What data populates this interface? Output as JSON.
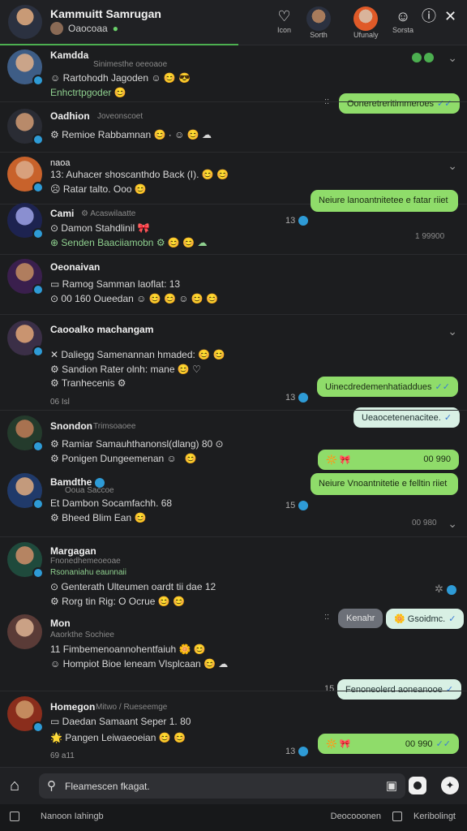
{
  "header": {
    "title": "Kammuitt Samrugan",
    "subtitle": "Oaocoaa",
    "icon_labels": [
      "Icon",
      "Sorth",
      "Ufunaly",
      "Sorsta",
      "",
      ""
    ]
  },
  "chats": [
    {
      "name": "Kamdda",
      "meta": "Sinimesthe oeeoaoe",
      "line1": "Rartohodh  Jagoden",
      "line2": "Enhctrtpgoder",
      "bubble": "Ooneretreritimmeroes",
      "tick": "✓✓"
    },
    {
      "name": "Oadhion",
      "meta": "Joveonscoet",
      "line1": "Remioe  Rabbamnan",
      "bubble": ""
    },
    {
      "name": "naoa",
      "line1": "Auhacer shoscanthdo Back (I).",
      "line2": "Ratar  talto. Ooo",
      "bubble": ""
    },
    {
      "name": "Cami",
      "meta": "Acaswilaatte",
      "line1": "Damon Stahdlinil",
      "line2": "Senden  Baaciiamobn",
      "bubble": "Neiure lanoantnitetee e fatar riiet",
      "count": "13",
      "time": "1 99900"
    },
    {
      "name": "Oeonaivan",
      "line1": "Ramog Samman laoflat: 13",
      "line2": "00  160  Oueedan",
      "bubble": ""
    },
    {
      "name": "Caooalko machangam",
      "line1": "Daliegg Samenannan hmaded:",
      "line2": "Sandion  Rater olnh:  mane",
      "line3": "Tranhecenis",
      "small": "06 Isl",
      "bubble": "Uinecdredemenhatiaddues",
      "bubble2": "Ueaocetenenacitee.",
      "count": "13"
    },
    {
      "name": "Snondon",
      "meta": "Trimsoaoee",
      "line1": "Ramiar Samauhthanonsl(dlang) 80",
      "line2": "Ponigen  Dungeemenan",
      "bubble": "",
      "time": "00 990"
    },
    {
      "name": "Bamdthe",
      "meta": "Ooua Saccoe",
      "line1": "Et Dambon Socamfachh. 68",
      "line2": "Bheed  Blim  Ean",
      "bubble": "Neiure Vnoantnitetie e felltin riiet",
      "count": "15",
      "time": "00 980"
    },
    {
      "name": "Margagan",
      "meta": "Fnonedhemeoeoae",
      "meta2": "Rsonaniahu  eaunnaii",
      "line1": "Genterath  Ulteumen oardt tii dae 12",
      "line2": "Rorg tin  Rig:  O Ocrue",
      "bubble_grey": "Kenahr",
      "bubble": "Gsoidmc."
    },
    {
      "name": "Mon",
      "meta": "Aaorkthe Sochiee",
      "line1": "11  Fimbemenoannohentfaiuh",
      "line2": "Hompiot  Bioe leneam  Vlsplcaan",
      "bubble": "Fenoneolerd aoneanooe",
      "count": "15"
    },
    {
      "name": "Homegon",
      "meta": "Mitwo / Rueseemge",
      "line1": "Daedan Samaant Seper 1. 80",
      "line2": "Pangen  Leiwaeoeian",
      "small": "69 a11",
      "bubble": "",
      "time": "00 990",
      "count": "13"
    }
  ],
  "composer": {
    "placeholder": "Fleamescen fkagat."
  },
  "bottombar": {
    "left1": "Nanoon Iahingb",
    "right1": "Deocooonen",
    "right2": "Keribolingt"
  },
  "colors": {
    "accent": "#4caf50",
    "bubble": "#8fdc6a",
    "background": "#1c1d1f"
  }
}
